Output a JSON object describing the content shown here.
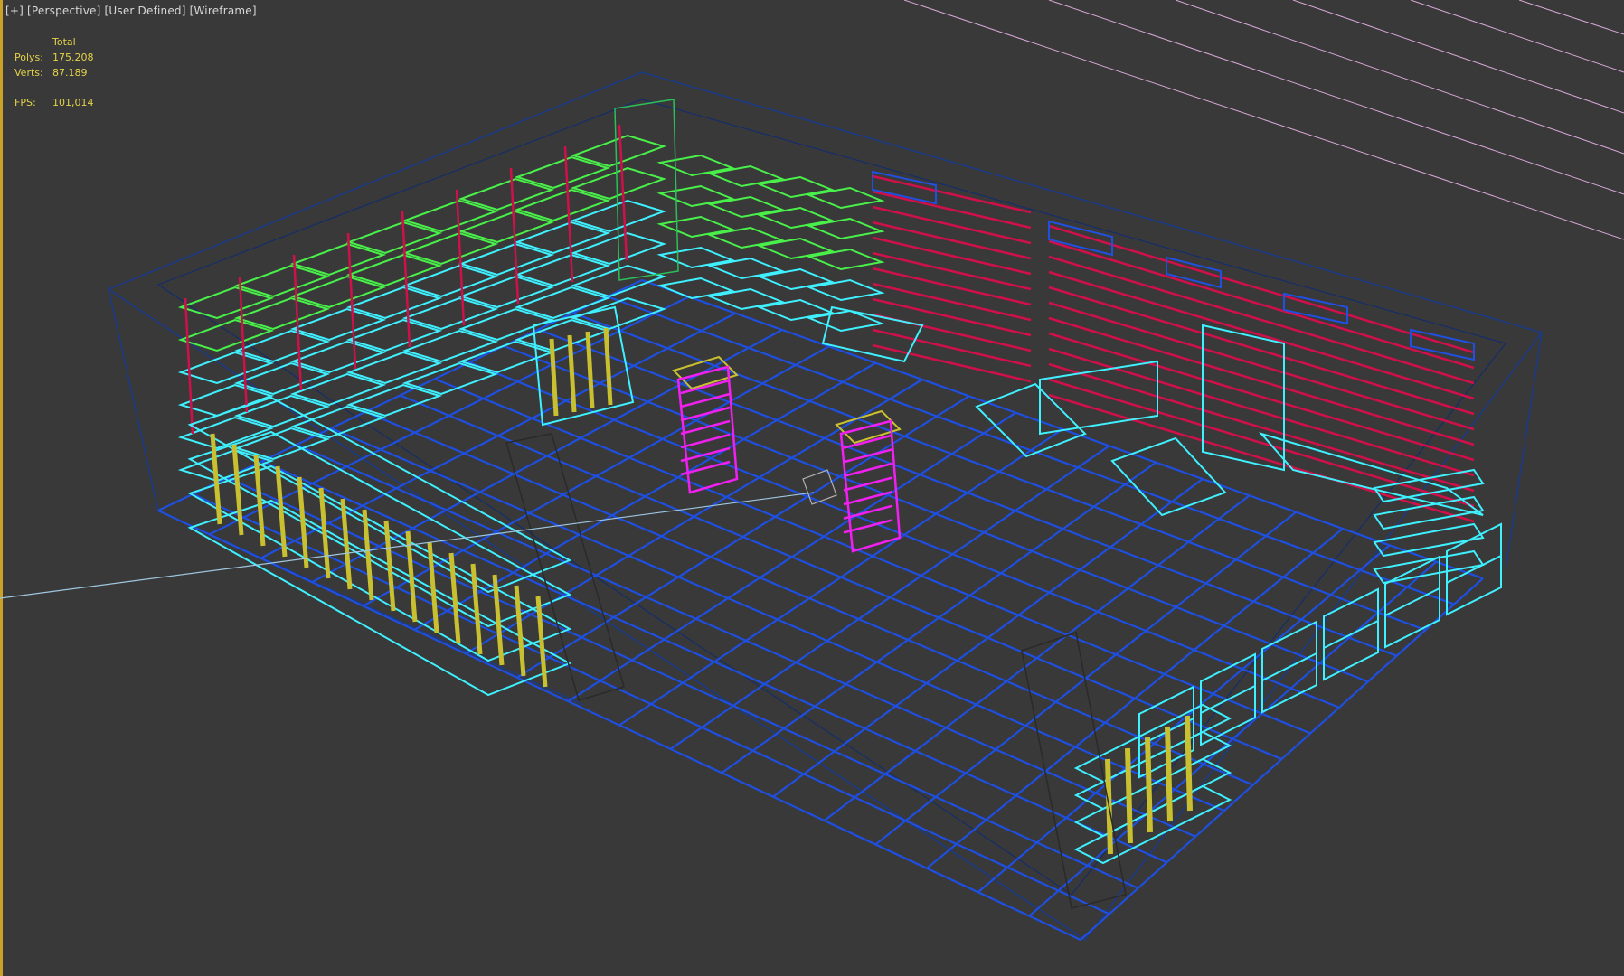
{
  "viewport": {
    "labels": [
      "[+]",
      "[Perspective]",
      "[User Defined]",
      "[Wireframe]"
    ]
  },
  "stats": {
    "header": "Total",
    "polys_label": "Polys:",
    "polys_value": "175.208",
    "verts_label": "Verts:",
    "verts_value": "87.189",
    "fps_label": "FPS:",
    "fps_value": "101,014"
  },
  "colors": {
    "background": "#393939",
    "grid": "#1e4fe0",
    "room": "#1a3a8a",
    "cyan": "#3ff0ff",
    "green": "#49f04a",
    "red": "#d0104a",
    "magenta": "#f020f0",
    "yellow": "#c8c030",
    "frame_border": "#c9a227",
    "stats_text": "#e3d24a"
  }
}
